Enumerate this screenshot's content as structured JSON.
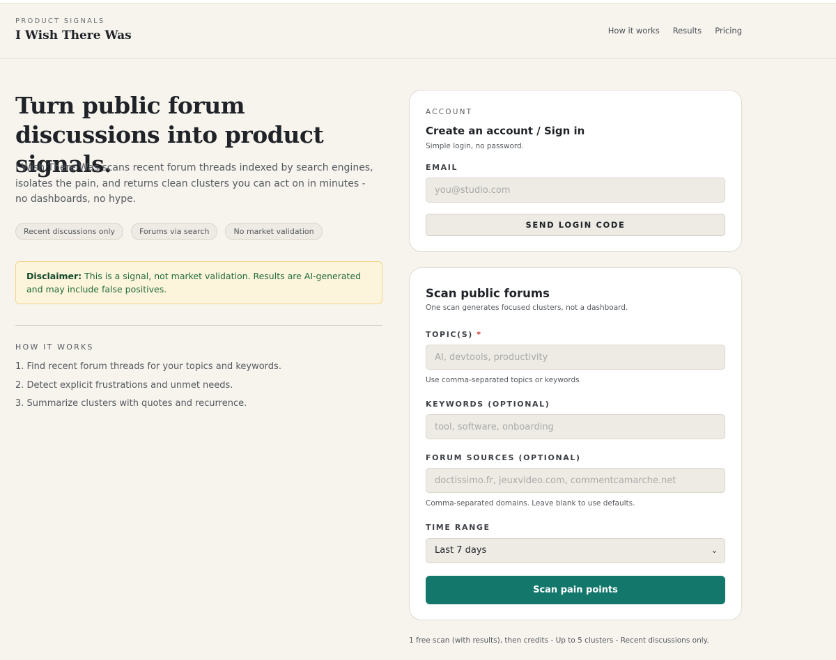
{
  "header": {
    "eyebrow": "PRODUCT SIGNALS",
    "brand": "I Wish There Was",
    "nav": [
      "How it works",
      "Results",
      "Pricing"
    ]
  },
  "hero": {
    "title": "Turn public forum discussions into product signals.",
    "description": "I Wish There Was scans recent forum threads indexed by search engines, isolates the pain, and returns clean clusters you can act on in minutes - no dashboards, no hype.",
    "pills": [
      "Recent discussions only",
      "Forums via search",
      "No market validation"
    ]
  },
  "disclaimer": {
    "label": "Disclaimer:",
    "text": "This is a signal, not market validation. Results are AI-generated and may include false positives."
  },
  "how_it_works": {
    "eyebrow": "HOW IT WORKS",
    "steps": [
      "1. Find recent forum threads for your topics and keywords.",
      "2. Detect explicit frustrations and unmet needs.",
      "3. Summarize clusters with quotes and recurrence."
    ]
  },
  "account": {
    "eyebrow": "ACCOUNT",
    "title": "Create an account / Sign in",
    "subtitle": "Simple login, no password.",
    "email_label": "EMAIL",
    "email_placeholder": "you@studio.com",
    "email_value": "",
    "button": "SEND LOGIN CODE"
  },
  "scan": {
    "title": "Scan public forums",
    "subtitle": "One scan generates focused clusters, not a dashboard.",
    "topics_label": "TOPIC(S)",
    "required_mark": "*",
    "topics_placeholder": "AI, devtools, productivity",
    "topics_hint": "Use comma-separated topics or keywords",
    "keywords_label": "KEYWORDS (OPTIONAL)",
    "keywords_placeholder": "tool, software, onboarding",
    "sources_label": "FORUM SOURCES (OPTIONAL)",
    "sources_placeholder": "doctissimo.fr, jeuxvideo.com, commentcamarche.net",
    "sources_hint": "Comma-separated domains. Leave blank to use defaults.",
    "time_label": "TIME RANGE",
    "time_value": "Last 7 days",
    "button": "Scan pain points"
  },
  "footnote": "1 free scan (with results), then credits - Up to 5 clusters - Recent discussions only.",
  "colors": {
    "background": "#f7f4ee",
    "accent": "#14776c",
    "disclaimer_bg": "#fdf4dc",
    "disclaimer_text": "#1f6b3a"
  }
}
